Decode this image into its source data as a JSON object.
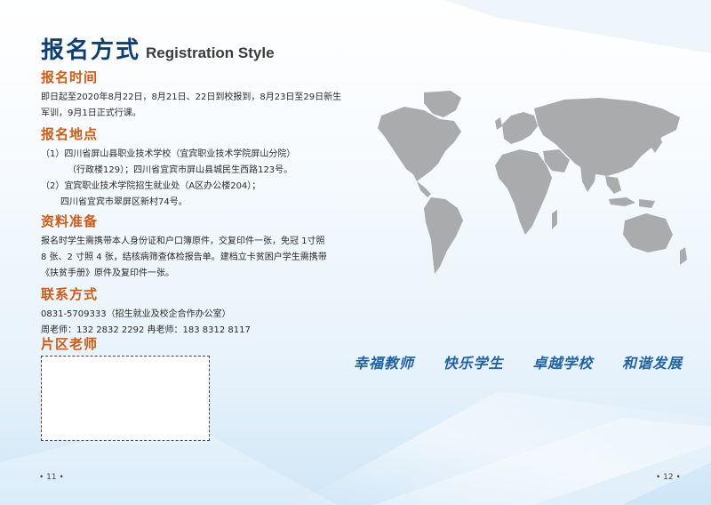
{
  "header": {
    "title_cn": "报名方式",
    "title_en": "Registration Style"
  },
  "sections": {
    "time": {
      "heading": "报名时间",
      "lines": [
        "即日起至2020年8月22日，8月21日、22日到校报到，8月23日至29日新生",
        "军训，9月1日正式行课。"
      ]
    },
    "location": {
      "heading": "报名地点",
      "lines": [
        "（1）四川省屏山县职业技术学校（宜宾职业技术学院屏山分院）",
        "（行政楼129）；四川省宜宾市屏山县城民生西路123号。",
        "（2）宜宾职业技术学院招生就业处（A区办公楼204）；",
        "四川省宜宾市翠屏区新村74号。"
      ]
    },
    "materials": {
      "heading": "资料准备",
      "lines": [
        "报名时学生需携带本人身份证和户口簿原件，交复印件一张，免冠 1寸照",
        "8 张、2 寸照 4 张，结核病筛查体检报告单。建档立卡贫困户学生需携带",
        "《扶贫手册》原件及复印件一张。"
      ]
    },
    "contact": {
      "heading": "联系方式",
      "lines": [
        "0831-5709333（招生就业及校企合作办公室）",
        "周老师：132 2832 2292    冉老师：183 8312 8117"
      ]
    },
    "teacher": {
      "heading": "片区老师"
    }
  },
  "slogans": [
    "幸福教师",
    "快乐学生",
    "卓越学校",
    "和谐发展"
  ],
  "page_numbers": {
    "left": "• 11 •",
    "right": "• 12 •"
  },
  "colors": {
    "title": "#0e3f72",
    "heading": "#d35a12",
    "slogan": "#1f62a8",
    "map": "#a9abad"
  },
  "icons": {
    "map": "world-map-icon"
  }
}
